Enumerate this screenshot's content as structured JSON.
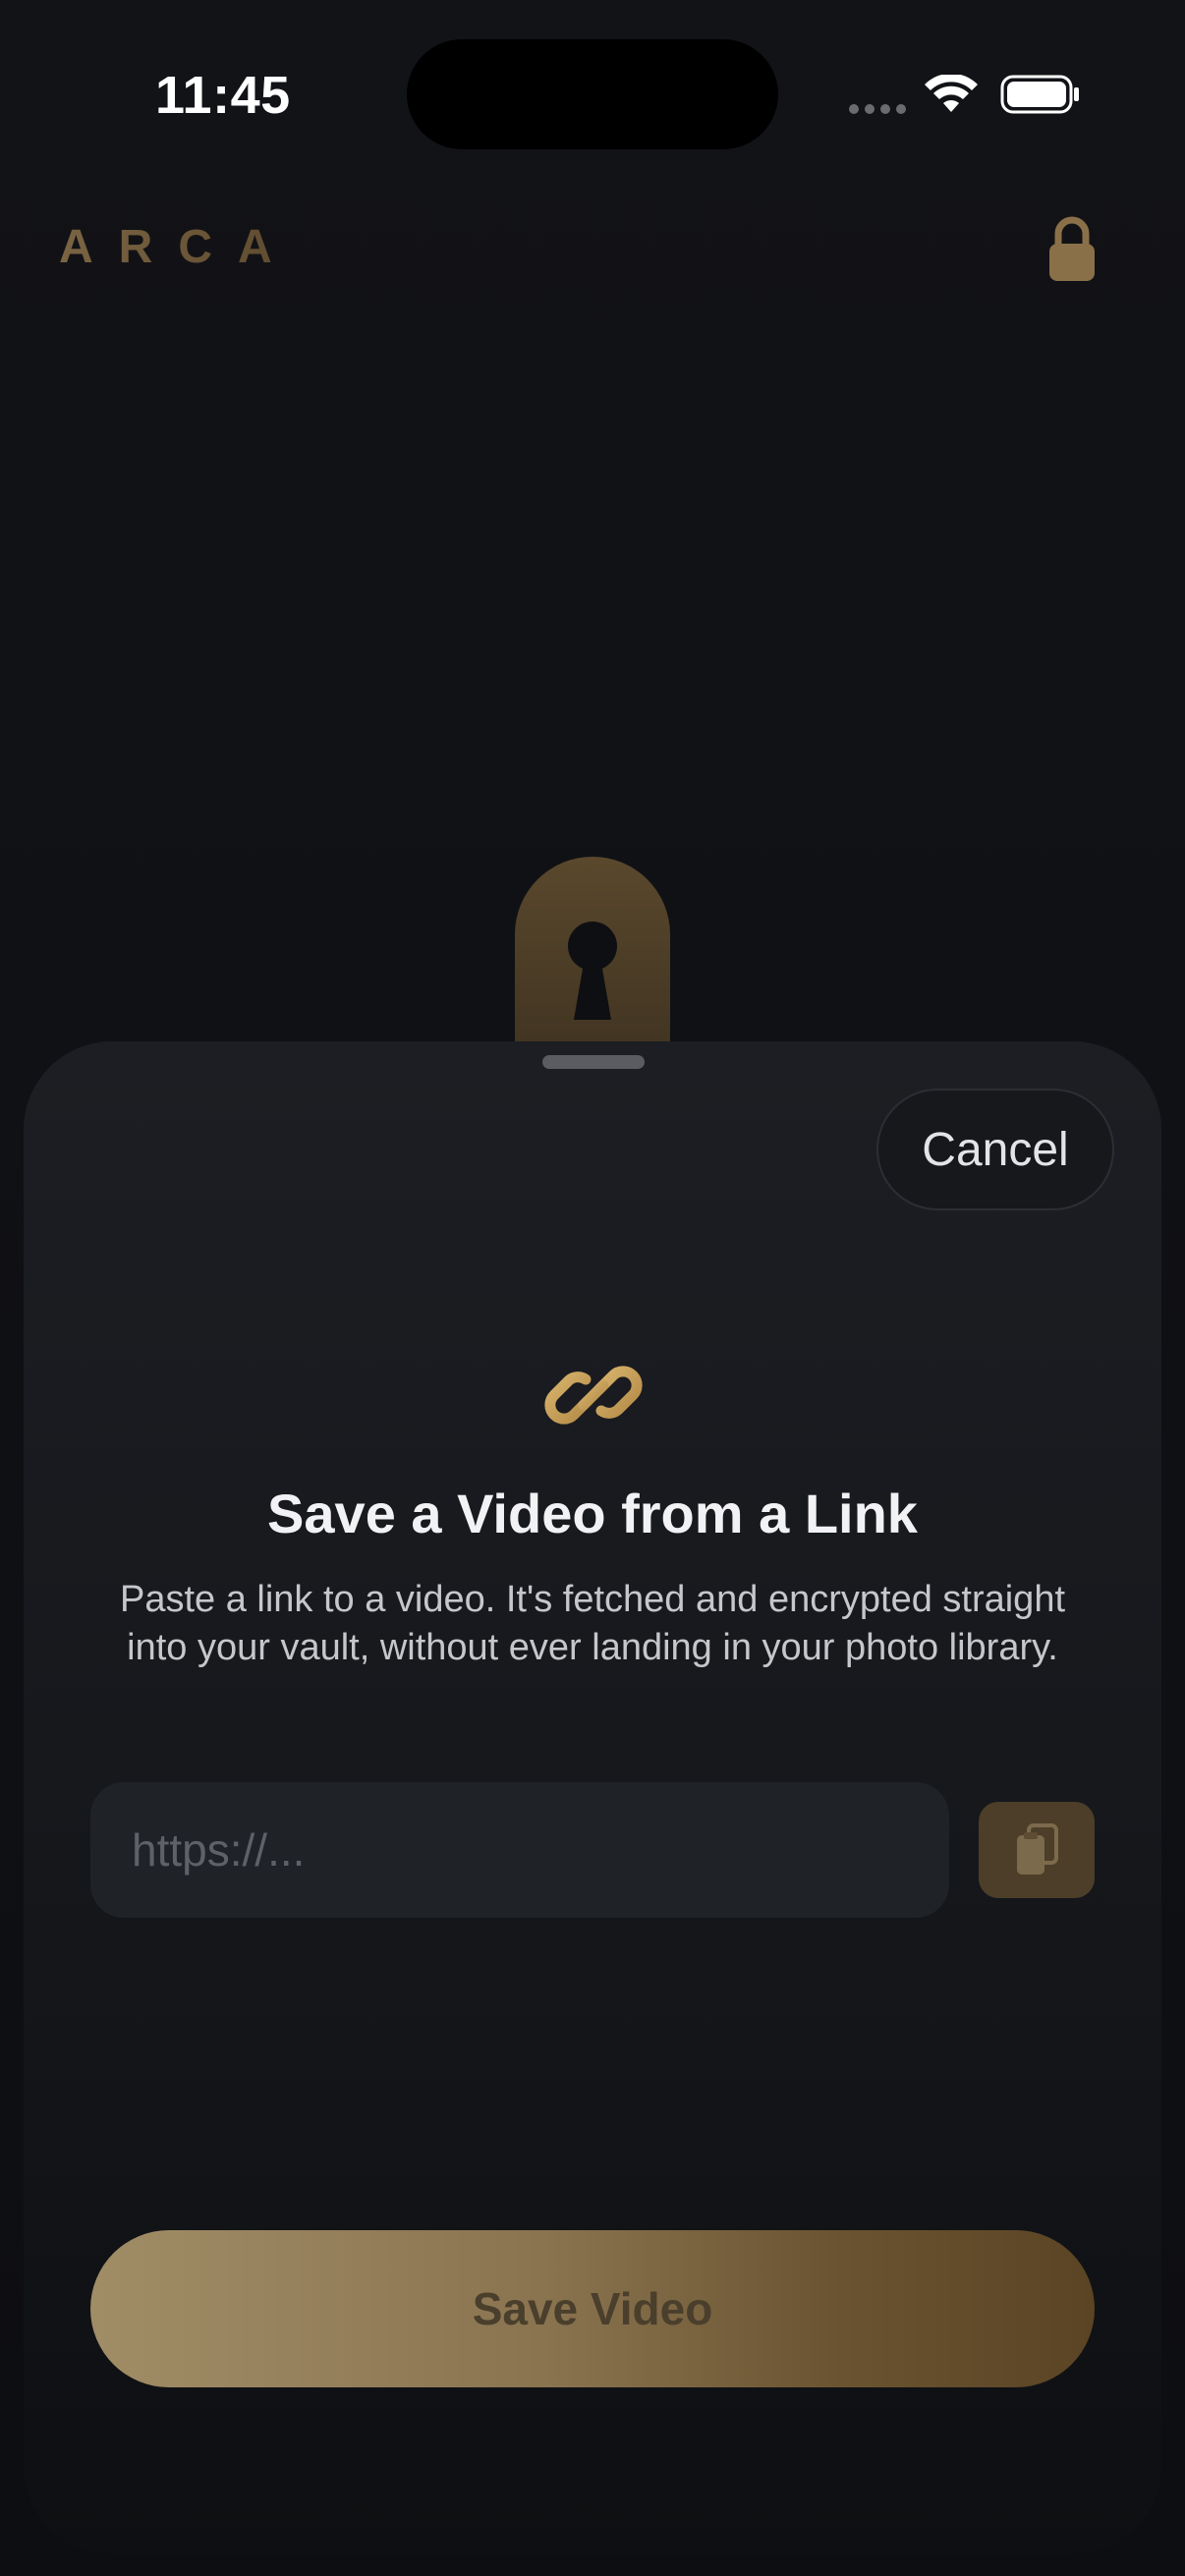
{
  "status_bar": {
    "time": "11:45"
  },
  "header": {
    "app_name": "ARCA",
    "lock_icon": "lock-icon"
  },
  "sheet": {
    "cancel_label": "Cancel",
    "icon": "link-icon",
    "title": "Save a Video from a Link",
    "description": "Paste a link to a video. It's fetched and encrypted straight into your vault, without ever landing in your photo library.",
    "url_field": {
      "value": "",
      "placeholder": "https://..."
    },
    "paste_icon": "clipboard-icon",
    "save_label": "Save Video"
  },
  "colors": {
    "accent_gold": "#c9a45f",
    "background": "#0e0f12",
    "sheet": "#1c1e23"
  }
}
